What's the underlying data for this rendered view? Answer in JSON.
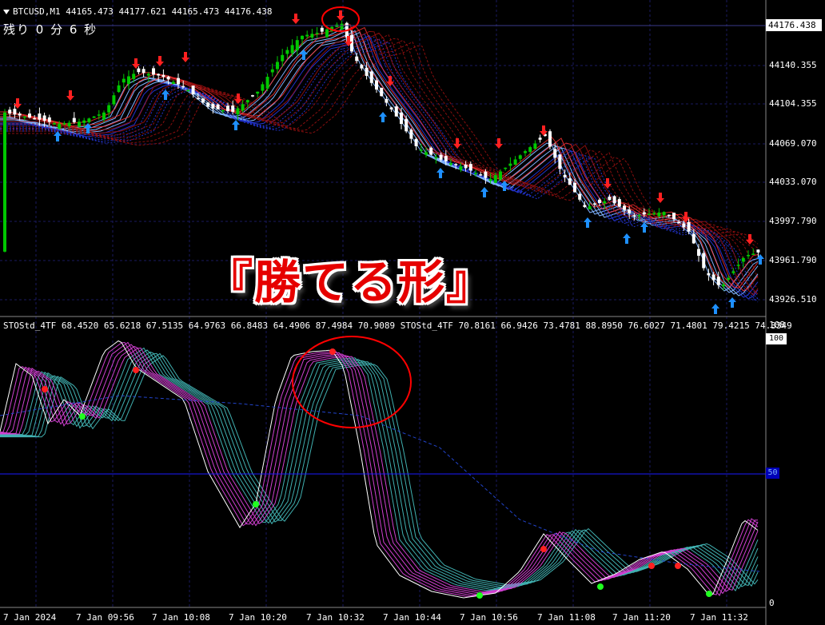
{
  "header": {
    "symbol": "BTCUSD,M1",
    "ohlc": "44165.473 44177.621 44165.473 44176.438"
  },
  "remaining": "残り 0 分 6 秒",
  "indicator_header": "STOStd_4TF 68.4520 65.6218 67.5135 64.9763 66.8483 64.4906 87.4984 70.9089 STOStd_4TF 70.8161 66.9426 73.4781 88.8950 76.6027 71.4801 79.4215 74.3349",
  "indicator_right_top": "108",
  "indicator_levels": {
    "top": "100",
    "mid": "50",
    "bottom": "0"
  },
  "current_price": "44176.438",
  "price_axis": [
    "44140.355",
    "44104.355",
    "44069.070",
    "44033.070",
    "43997.790",
    "43961.790",
    "43926.510"
  ],
  "time_axis": [
    "7 Jan 2024",
    "7 Jan 09:56",
    "7 Jan 10:08",
    "7 Jan 10:20",
    "7 Jan 10:32",
    "7 Jan 10:44",
    "7 Jan 10:56",
    "7 Jan 11:08",
    "7 Jan 11:20",
    "7 Jan 11:32"
  ],
  "banner": "『勝てる形』",
  "colors": {
    "bull": "#00c800",
    "bear": "#ffffff",
    "arrow_up": "#1e90ff",
    "arrow_down": "#ff2020",
    "grid": "#1a1a60",
    "highlight": "#ff0000"
  }
}
